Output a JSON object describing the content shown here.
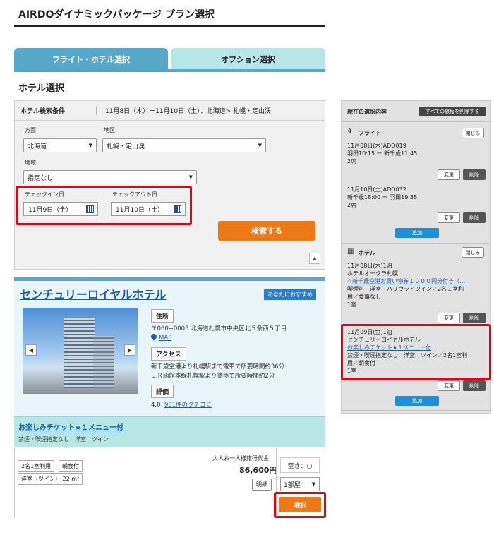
{
  "page": {
    "title": "AIRDOダイナミックパッケージ プラン選択"
  },
  "tabs": [
    {
      "label": "フライト・ホテル選択"
    },
    {
      "label": "オプション選択"
    }
  ],
  "section": {
    "title": "ホテル選択"
  },
  "search": {
    "header_label": "ホテル検索条件",
    "summary": "11月8日（木）ー11月10日（土）、北海道> 札幌・定山渓",
    "direction_label": "方面",
    "direction_value": "北海道",
    "area_label": "地区",
    "area_value": "札幌・定山渓",
    "region_label": "地域",
    "region_value": "指定なし",
    "checkin_label": "チェックイン日",
    "checkin_value": "11月9日（金）",
    "checkout_label": "チェックアウト日",
    "checkout_value": "11月10日（土）",
    "search_button": "検索する",
    "collapse_symbol": "▲"
  },
  "hotel": {
    "name": "センチュリーロイヤルホテル",
    "recommend_badge": "あなたにおすすめ",
    "address_tag": "住所",
    "address": "〒060−0005 北海道札幌市中央区北５条西５丁目",
    "map_link": "MAP",
    "access_tag": "アクセス",
    "access_line1": "新千歳空港より札幌駅まで電車で所要時間約36分",
    "access_line2": "ＪＲ函館本線札幌駅より徒歩で所要時間約2分",
    "rating_tag": "評価",
    "rating": "4.0",
    "reviews_link": "901件のクチコミ",
    "prev_symbol": "◀",
    "next_symbol": "▶"
  },
  "plan": {
    "name": "お楽しみチケット★１メニュー付",
    "description": "禁煙・喫煙指定なし　洋室　ツイン",
    "chip_occupancy": "2名1室利用",
    "chip_meal": "朝食付",
    "chip_room": "洋室（ツイン） 22 m²",
    "price_label": "大人お一人様旅行代金",
    "price": "86,600円",
    "detail_button": "明細",
    "availability": "空き：○",
    "rooms_value": "1部屋",
    "select_button": "選択"
  },
  "sidebar": {
    "title": "現在の選択内容",
    "clear_all": "すべての旅程を削除する",
    "flight_label": "フライト",
    "flight_close": "閉じる",
    "flight1_line1": "11月08日(木)ADO019",
    "flight1_line2": "羽田10:15 ー 新千歳11:45",
    "flight1_line3": "2席",
    "flight2_line1": "11月10日(土)ADO032",
    "flight2_line2": "新千歳18:00 ー 羽田19:35",
    "flight2_line3": "2席",
    "edit": "変更",
    "delete": "削除",
    "add": "追加",
    "hotel_label": "ホテル",
    "hotel_close": "閉じる",
    "hotel1_line1": "11月08日(木)1泊",
    "hotel1_line2": "ホテルオークラ札幌",
    "hotel1_line3": "☆新千歳空港お買い物券１０００円分付き（…",
    "hotel1_line4": "喫煙可　洋室　ハリウッドツイン／2名１室利",
    "hotel1_line5": "用／食事なし",
    "hotel1_line6": "1室",
    "hotel2_line1": "11月09日(金)1泊",
    "hotel2_line2": "センチュリーロイヤルホテル",
    "hotel2_line3": "お楽しみチケット★１メニュー付",
    "hotel2_line4": "禁煙・喫煙指定なし　洋室　ツイン／2名1室利",
    "hotel2_line5": "用／朝食付",
    "hotel2_line6": "1室"
  }
}
